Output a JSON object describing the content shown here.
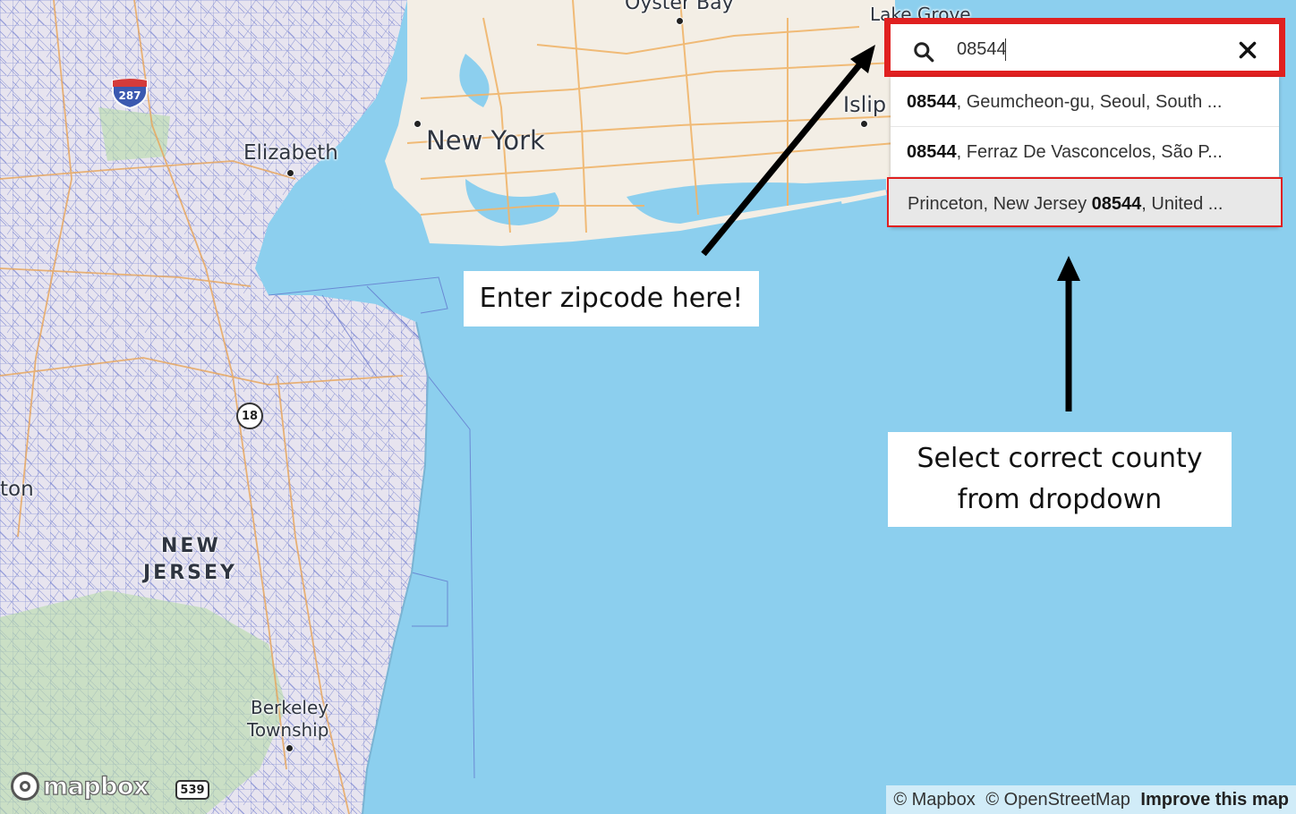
{
  "search": {
    "value": "08544",
    "placeholder": "Search"
  },
  "suggestions": [
    {
      "before": "",
      "bold": "08544",
      "after": ", Geumcheon-gu, Seoul, South ...",
      "active": false
    },
    {
      "before": "",
      "bold": "08544",
      "after": ", Ferraz De Vasconcelos, São P...",
      "active": false
    },
    {
      "before": "Princeton, New Jersey ",
      "bold": "08544",
      "after": ", United ...",
      "active": true
    }
  ],
  "callouts": {
    "zip": "Enter zipcode here!",
    "county_line1": "Select correct county",
    "county_line2": "from dropdown"
  },
  "map_labels": {
    "oyster_bay": "Oyster Bay",
    "lake_grove": "Lake Grove",
    "islip": "Islip",
    "new_york": "New York",
    "elizabeth": "Elizabeth",
    "new": "NEW",
    "jersey": "JERSEY",
    "berkeley": "Berkeley",
    "township": "Township",
    "ton": "ton"
  },
  "shields": {
    "interstate": "287",
    "state_route": "18",
    "county_route": "539"
  },
  "footer": {
    "logo": "mapbox",
    "attr_mapbox": "© Mapbox",
    "attr_osm": "© OpenStreetMap",
    "improve": "Improve this map"
  },
  "colors": {
    "water": "#8ccfee",
    "land": "#f3eee5",
    "roads_major": "#f0b56b",
    "tract_lines": "#5b6cc9",
    "highlight": "#e02020",
    "park": "#b8dca8"
  }
}
